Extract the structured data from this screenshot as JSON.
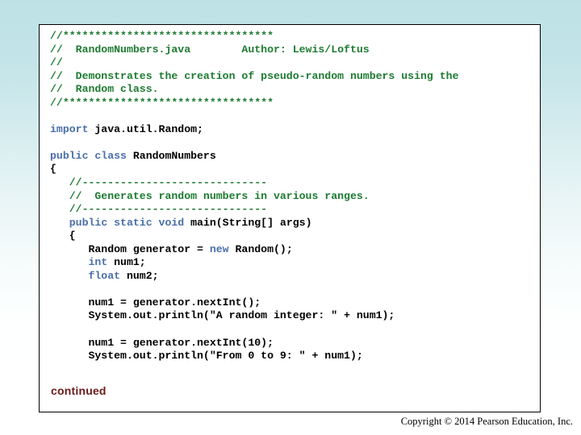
{
  "slide": {
    "background_top_color": "#bde2e6",
    "background_bottom_color": "#ffffff"
  },
  "code_panel": {
    "border_color": "#000000",
    "background_color": "#ffffff",
    "comment_color": "#1e7b32",
    "keyword_color": "#4a6fa8",
    "plain_color": "#000000",
    "lines": [
      [
        {
          "t": "//*********************************",
          "c": "cmt"
        }
      ],
      [
        {
          "t": "//  RandomNumbers.java        Author: Lewis/Loftus",
          "c": "cmt"
        }
      ],
      [
        {
          "t": "//",
          "c": "cmt"
        }
      ],
      [
        {
          "t": "//  Demonstrates the creation of pseudo-random numbers using the",
          "c": "cmt"
        }
      ],
      [
        {
          "t": "//  Random class.",
          "c": "cmt"
        }
      ],
      [
        {
          "t": "//*********************************",
          "c": "cmt"
        }
      ],
      [
        {
          "t": "",
          "c": "pln"
        }
      ],
      [
        {
          "t": "import",
          "c": "kw"
        },
        {
          "t": " java.util.Random;",
          "c": "pln"
        }
      ],
      [
        {
          "t": "",
          "c": "pln"
        }
      ],
      [
        {
          "t": "public class",
          "c": "kw"
        },
        {
          "t": " RandomNumbers",
          "c": "pln"
        }
      ],
      [
        {
          "t": "{",
          "c": "pln"
        }
      ],
      [
        {
          "t": "   //-----------------------------",
          "c": "cmt"
        }
      ],
      [
        {
          "t": "   //  Generates random numbers in various ranges.",
          "c": "cmt"
        }
      ],
      [
        {
          "t": "   //-----------------------------",
          "c": "cmt"
        }
      ],
      [
        {
          "t": "   ",
          "c": "pln"
        },
        {
          "t": "public static void",
          "c": "kw"
        },
        {
          "t": " main(String[] args)",
          "c": "pln"
        }
      ],
      [
        {
          "t": "   {",
          "c": "pln"
        }
      ],
      [
        {
          "t": "      Random generator = ",
          "c": "pln"
        },
        {
          "t": "new",
          "c": "kw"
        },
        {
          "t": " Random();",
          "c": "pln"
        }
      ],
      [
        {
          "t": "      ",
          "c": "pln"
        },
        {
          "t": "int",
          "c": "kw"
        },
        {
          "t": " num1;",
          "c": "pln"
        }
      ],
      [
        {
          "t": "      ",
          "c": "pln"
        },
        {
          "t": "float",
          "c": "kw"
        },
        {
          "t": " num2;",
          "c": "pln"
        }
      ],
      [
        {
          "t": "",
          "c": "pln"
        }
      ],
      [
        {
          "t": "      num1 = generator.nextInt();",
          "c": "pln"
        }
      ],
      [
        {
          "t": "      System.out.println(\"A random integer: \" + num1);",
          "c": "pln"
        }
      ],
      [
        {
          "t": "",
          "c": "pln"
        }
      ],
      [
        {
          "t": "      num1 = generator.nextInt(10);",
          "c": "pln"
        }
      ],
      [
        {
          "t": "      System.out.println(\"From 0 to 9: \" + num1);",
          "c": "pln"
        }
      ]
    ],
    "continued_label": "continued",
    "continued_color": "#6b1a1a"
  },
  "footer": {
    "copyright": "Copyright © 2014 Pearson Education, Inc."
  }
}
